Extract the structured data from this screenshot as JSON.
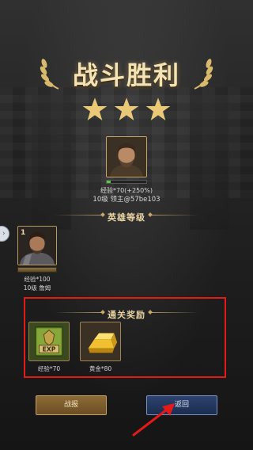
{
  "header": {
    "title": "战斗胜利",
    "stars_earned": 3,
    "star_color": "#e9c978"
  },
  "leader": {
    "exp_text": "经验*70(+250%)",
    "name_text": "10级 领主@57be103",
    "exp_progress": 0.1,
    "progress_color": "#5cc84a"
  },
  "hero_section": {
    "title": "英雄等级"
  },
  "hero": {
    "badge": "1",
    "exp_text": "经验*100",
    "name_text": "10级 詹姆"
  },
  "reward_section": {
    "title": "通关奖励",
    "items": [
      {
        "icon": "exp-book-icon",
        "icon_text": "EXP",
        "label": "经验*70"
      },
      {
        "icon": "gold-bar-icon",
        "label": "黄金*80"
      }
    ]
  },
  "buttons": {
    "report_label": "战报",
    "back_label": "返回"
  },
  "colors": {
    "highlight_box": "#e21a1a",
    "arrow": "#e21a1a"
  }
}
